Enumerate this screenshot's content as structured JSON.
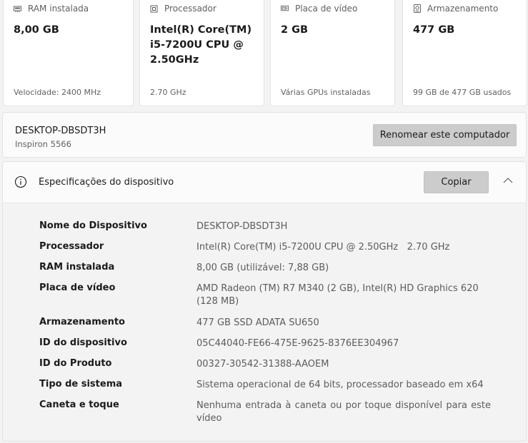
{
  "cards": [
    {
      "label": "RAM instalada",
      "value": "8,00 GB",
      "sub": "Velocidade: 2400 MHz",
      "icon": "ram-icon"
    },
    {
      "label": "Processador",
      "value": "Intel(R) Core(TM) i5-7200U CPU @ 2.50GHz",
      "sub": "2.70 GHz",
      "icon": "processor-icon"
    },
    {
      "label": "Placa de vídeo",
      "value": "2 GB",
      "sub": "Várias GPUs instaladas",
      "icon": "gpu-icon"
    },
    {
      "label": "Armazenamento",
      "value": "477 GB",
      "sub": "99 GB de 477 GB usados",
      "icon": "storage-icon"
    }
  ],
  "computer": {
    "name": "DESKTOP-DBSDT3H",
    "model": "Inspiron 5566",
    "rename_label": "Renomear este computador"
  },
  "specs": {
    "title": "Especificações do dispositivo",
    "copy_label": "Copiar",
    "rows": [
      {
        "key": "Nome do Dispositivo",
        "value": "DESKTOP-DBSDT3H"
      },
      {
        "key": "Processador",
        "value": "Intel(R) Core(TM) i5-7200U CPU @ 2.50GHz   2.70 GHz"
      },
      {
        "key": "RAM instalada",
        "value": "8,00 GB (utilizável: 7,88 GB)"
      },
      {
        "key": "Placa de vídeo",
        "value": "AMD Radeon (TM) R7 M340 (2 GB), Intel(R) HD Graphics 620 (128 MB)"
      },
      {
        "key": "Armazenamento",
        "value": "477 GB SSD ADATA SU650"
      },
      {
        "key": "ID do dispositivo",
        "value": "05C44040-FE66-475E-9625-8376EE304967"
      },
      {
        "key": "ID do Produto",
        "value": "00327-30542-31388-AAOEM"
      },
      {
        "key": "Tipo de sistema",
        "value": "Sistema operacional de 64 bits, processador baseado em x64"
      },
      {
        "key": "Caneta e toque",
        "value": "Nenhuma entrada à caneta ou por toque disponível para este vídeo"
      }
    ]
  }
}
